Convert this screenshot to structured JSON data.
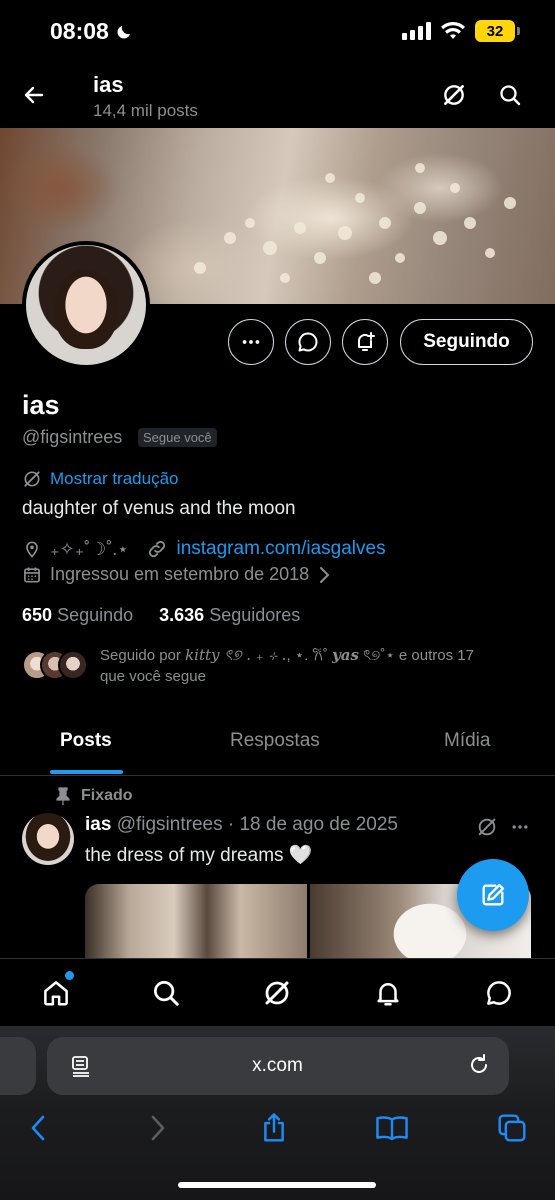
{
  "status_bar": {
    "time": "08:08",
    "battery": "32"
  },
  "header": {
    "name": "ias",
    "post_count": "14,4 mil posts"
  },
  "profile": {
    "display_name": "ias",
    "handle": "@figsintrees",
    "follows_you_badge": "Segue você",
    "translate_label": "Mostrar tradução",
    "bio": "daughter of venus and the moon",
    "location": "₊✧₊˚☽˚.⋆",
    "website": "instagram.com/iasgalves",
    "joined": "Ingressou em setembro de 2018",
    "follow_button": "Seguindo",
    "following_count": "650",
    "following_label": "Seguindo",
    "followers_count": "3.636",
    "followers_label": "Seguidores",
    "followed_by_line1": "Seguido por ",
    "followed_by_name1": "kitty ৎ୭ . ₊ ⊹ .",
    "followed_by_mid": ", ⋆. 𐙚˚",
    "followed_by_name2": "yas",
    "followed_by_end": " ৎ୭˚⋆ e outros 17",
    "followed_by_line2": "que você segue"
  },
  "tabs": [
    {
      "label": "Posts"
    },
    {
      "label": "Respostas"
    },
    {
      "label": "Mídia"
    }
  ],
  "pinned_post": {
    "pinned_label": "Fixado",
    "author_name": "ias",
    "author_handle": "@figsintrees",
    "date": "· 18 de ago de 2025",
    "text": "the dress of my dreams 🤍"
  },
  "browser": {
    "url": "x.com"
  },
  "colors": {
    "accent": "#1d9bf0",
    "background": "#000000",
    "muted": "#8b8f94"
  }
}
